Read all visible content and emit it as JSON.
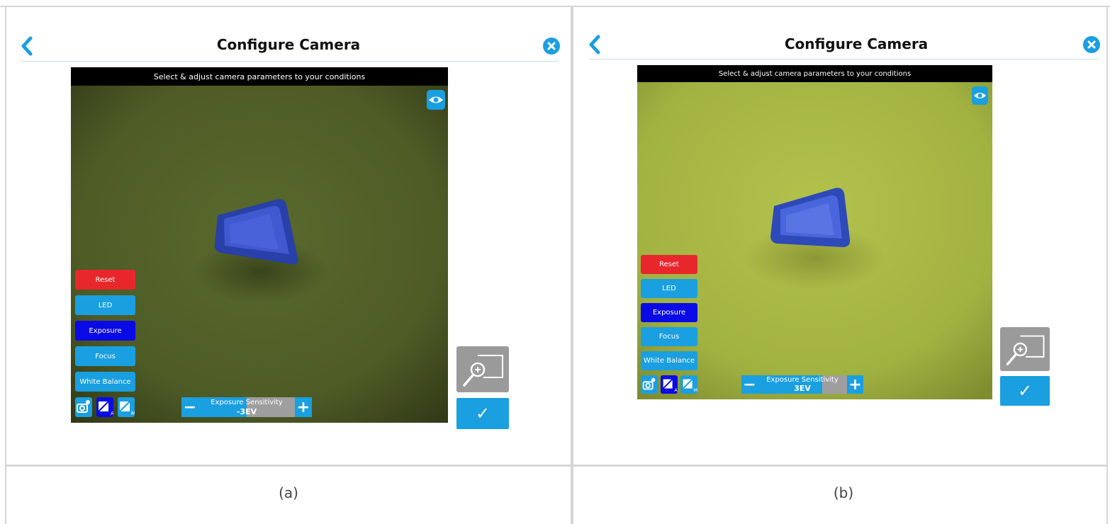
{
  "panels": [
    {
      "header": {
        "title": "Configure Camera"
      },
      "camera": {
        "banner": "Select & adjust camera parameters to your conditions"
      },
      "side_buttons": {
        "reset": "Reset",
        "led": "LED",
        "exposure": "Exposure",
        "focus": "Focus",
        "white_balance": "White Balance"
      },
      "exposure_control": {
        "label": "Exposure Sensitivity",
        "value": "-3EV",
        "level_fraction": 0.5
      },
      "confirm": {
        "symbol": "✓"
      },
      "colors": {
        "accent": "#1a9fe0",
        "reset": "#e8272c",
        "exposure_active": "#0a0ae6",
        "background": "#4e5a26"
      }
    },
    {
      "header": {
        "title": "Configure Camera"
      },
      "camera": {
        "banner": "Select & adjust camera parameters to your conditions"
      },
      "side_buttons": {
        "reset": "Reset",
        "led": "LED",
        "exposure": "Exposure",
        "focus": "Focus",
        "white_balance": "White Balance"
      },
      "exposure_control": {
        "label": "Exposure Sensitivity",
        "value": "3EV",
        "level_fraction": 0.72
      },
      "confirm": {
        "symbol": "✓"
      },
      "colors": {
        "accent": "#1a9fe0",
        "reset": "#e8272c",
        "exposure_active": "#0a0ae6",
        "background": "#a6b643"
      }
    }
  ],
  "captions": [
    "(a)",
    "(b)"
  ]
}
